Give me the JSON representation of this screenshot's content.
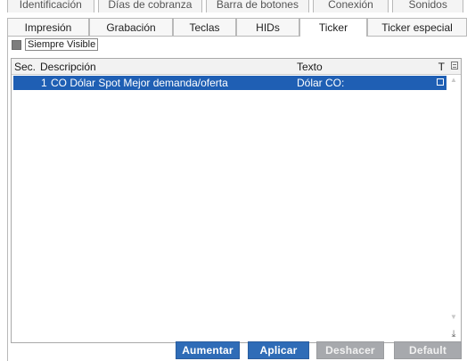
{
  "tabs_back": [
    {
      "label": "Identificación"
    },
    {
      "label": "Días de cobranza"
    },
    {
      "label": "Barra de botones"
    },
    {
      "label": "Conexión"
    },
    {
      "label": "Sonidos"
    }
  ],
  "tabs_front": [
    {
      "label": "Impresión",
      "active": false
    },
    {
      "label": "Grabación",
      "active": false
    },
    {
      "label": "Teclas",
      "active": false
    },
    {
      "label": "HIDs",
      "active": false
    },
    {
      "label": "Ticker",
      "active": true
    },
    {
      "label": "Ticker especial",
      "active": false
    }
  ],
  "options": {
    "siempre_visible_label": "Siempre Visible",
    "siempre_visible_checked": true
  },
  "table": {
    "columns": [
      {
        "label": "Sec."
      },
      {
        "label": "Descripción"
      },
      {
        "label": "Texto"
      },
      {
        "label": "T"
      }
    ],
    "rows": [
      {
        "sec": "1",
        "descripcion": "CO Dólar Spot Mejor demanda/oferta",
        "texto": "Dólar CO:",
        "selected": true
      }
    ]
  },
  "buttons": {
    "aumentar": "Aumentar",
    "aplicar": "Aplicar",
    "deshacer": "Deshacer",
    "default": "Default"
  },
  "icons": {
    "column_menu": "column-menu-icon",
    "scroll_end": "scroll-end-icon"
  },
  "colors": {
    "selection": "#1f5fb4",
    "primary_button": "#2f6cb7",
    "disabled_button": "#a7a9ad"
  }
}
